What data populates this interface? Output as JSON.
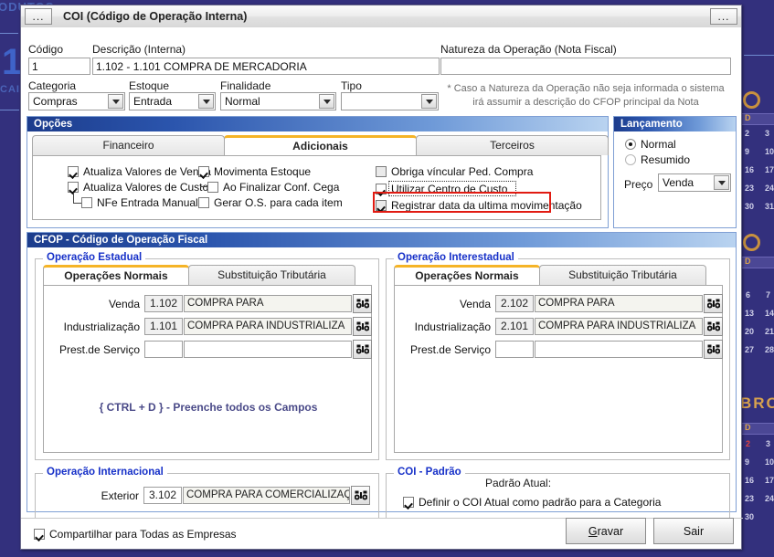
{
  "window": {
    "title": "COI (Código de Operação Interna)",
    "menu_button": "...",
    "options_button": "..."
  },
  "desktop": {
    "text_top": "ODUTOS",
    "text_left_big": "1",
    "text_cai": "CAI",
    "calendar_month": "BRO",
    "weekday_initial": "D",
    "weeks": [
      [
        "2",
        "3"
      ],
      [
        "9",
        "10"
      ],
      [
        "16",
        "17"
      ],
      [
        "23",
        "24"
      ],
      [
        "30",
        "31"
      ],
      [
        "6",
        "7"
      ],
      [
        "13",
        "14"
      ],
      [
        "20",
        "21"
      ],
      [
        "27",
        "28"
      ],
      [
        "2",
        "3"
      ],
      [
        "9",
        "10"
      ],
      [
        "16",
        "17"
      ],
      [
        "23",
        "24"
      ],
      [
        "30",
        ""
      ]
    ]
  },
  "form": {
    "codigo_label": "Código",
    "codigo_value": "1",
    "descricao_label": "Descrição (Interna)",
    "descricao_value": "1.102 - 1.101 COMPRA DE MERCADORIA",
    "natureza_label": "Natureza da Operação (Nota Fiscal)",
    "natureza_value": "",
    "categoria_label": "Categoria",
    "categoria_value": "Compras",
    "estoque_label": "Estoque",
    "estoque_value": "Entrada",
    "finalidade_label": "Finalidade",
    "finalidade_value": "Normal",
    "tipo_label": "Tipo",
    "tipo_value": "",
    "note_line1": "* Caso a Natureza da Operação não seja informada o sistema",
    "note_line2": "irá assumir a descrição do CFOP principal da Nota"
  },
  "opcoes": {
    "title": "Opções",
    "tabs": [
      {
        "label": "Financeiro",
        "active": false
      },
      {
        "label": "Adicionais",
        "active": true
      },
      {
        "label": "Terceiros",
        "active": false
      }
    ],
    "col1": [
      {
        "label": "Atualiza Valores de Venda",
        "checked": true
      },
      {
        "label": "Atualiza Valores de Custo",
        "checked": true
      },
      {
        "label": "NFe Entrada Manual",
        "checked": false
      }
    ],
    "col2": [
      {
        "label": "Movimenta Estoque",
        "checked": true
      },
      {
        "label": "Ao Finalizar Conf. Cega",
        "checked": false
      },
      {
        "label": "Gerar O.S. para cada item",
        "checked": false
      }
    ],
    "col3": [
      {
        "label": "Obriga víncular Ped. Compra",
        "checked": false
      },
      {
        "label": "Utilizar Centro de Custo",
        "checked": true
      },
      {
        "label": "Registrar data da ultima movimentação",
        "checked": true
      }
    ]
  },
  "lancamento": {
    "title": "Lançamento",
    "radios": [
      {
        "label": "Normal",
        "selected": true
      },
      {
        "label": "Resumido",
        "selected": false
      }
    ],
    "preco_label": "Preço",
    "preco_value": "Venda"
  },
  "cfop": {
    "title": "CFOP - Código de Operação Fiscal",
    "estadual": {
      "legend": "Operação Estadual",
      "tabs": [
        {
          "label": "Operações Normais",
          "active": true
        },
        {
          "label": "Substituição Tributária",
          "active": false
        }
      ],
      "rows": [
        {
          "label": "Venda",
          "code": "1.102",
          "desc": "COMPRA PARA",
          "icon": "binoculars-icon"
        },
        {
          "label": "Industrialização",
          "code": "1.101",
          "desc": "COMPRA PARA INDUSTRIALIZA",
          "icon": "binoculars-icon"
        },
        {
          "label": "Prest.de Serviço",
          "code": "",
          "desc": "",
          "icon": "binoculars-icon"
        }
      ],
      "hint": "{ CTRL + D } - Preenche todos os Campos"
    },
    "interestadual": {
      "legend": "Operação Interestadual",
      "tabs": [
        {
          "label": "Operações Normais",
          "active": true
        },
        {
          "label": "Substituição Tributária",
          "active": false
        }
      ],
      "rows": [
        {
          "label": "Venda",
          "code": "2.102",
          "desc": "COMPRA PARA",
          "icon": "binoculars-icon"
        },
        {
          "label": "Industrialização",
          "code": "2.101",
          "desc": "COMPRA PARA INDUSTRIALIZA",
          "icon": "binoculars-icon"
        },
        {
          "label": "Prest.de Serviço",
          "code": "",
          "desc": "",
          "icon": "binoculars-icon"
        }
      ]
    },
    "internacional": {
      "legend": "Operação Internacional",
      "row": {
        "label": "Exterior",
        "code": "3.102",
        "desc": "COMPRA PARA COMERCIALIZAÇ",
        "icon": "binoculars-icon"
      }
    },
    "padrao": {
      "legend": "COI - Padrão",
      "current_label": "Padrão Atual:",
      "current_value": "",
      "checkbox": {
        "label": "Definir o COI Atual como padrão para a Categoria",
        "checked": true
      }
    }
  },
  "footer": {
    "share_label": "Compartilhar para Todas as Empresas",
    "share_checked": true,
    "gravar_accel": "G",
    "gravar_rest": "ravar",
    "sair_label": "Sair"
  },
  "colors": {
    "panel_header_dark": "#1c3c8c",
    "legend_blue": "#1630c8",
    "tab_active_accent": "#f5b427",
    "highlight_red": "#e11b12",
    "desktop": "#33307d"
  }
}
